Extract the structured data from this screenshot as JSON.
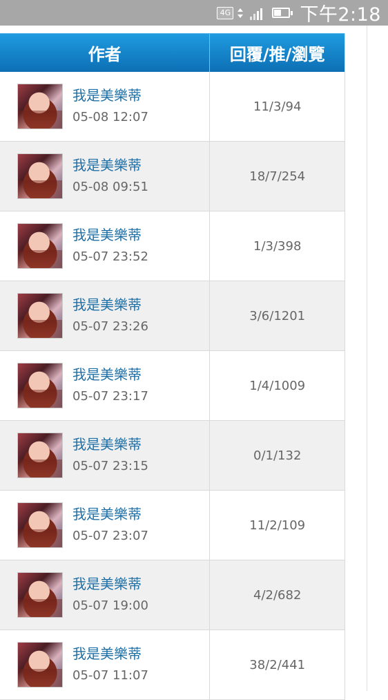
{
  "status_bar": {
    "network": "4G",
    "time": "下午2:18",
    "icons": [
      "network-4g-icon",
      "data-arrows-icon",
      "signal-icon",
      "battery-icon"
    ],
    "bar_color": "#a7a7a7"
  },
  "table": {
    "headers": [
      "作者",
      "回覆/推/瀏覽"
    ],
    "colors": {
      "header_start": "#1f9be0",
      "header_end": "#0d6fb4",
      "link": "#1e6fa6"
    },
    "rows": [
      {
        "name": "我是美樂蒂",
        "time": "05-08 12:07",
        "stats": "11/3/94"
      },
      {
        "name": "我是美樂蒂",
        "time": "05-08 09:51",
        "stats": "18/7/254"
      },
      {
        "name": "我是美樂蒂",
        "time": "05-07 23:52",
        "stats": "1/3/398"
      },
      {
        "name": "我是美樂蒂",
        "time": "05-07 23:26",
        "stats": "3/6/1201"
      },
      {
        "name": "我是美樂蒂",
        "time": "05-07 23:17",
        "stats": "1/4/1009"
      },
      {
        "name": "我是美樂蒂",
        "time": "05-07 23:15",
        "stats": "0/1/132"
      },
      {
        "name": "我是美樂蒂",
        "time": "05-07 23:07",
        "stats": "11/2/109"
      },
      {
        "name": "我是美樂蒂",
        "time": "05-07 19:00",
        "stats": "4/2/682"
      },
      {
        "name": "我是美樂蒂",
        "time": "05-07 11:07",
        "stats": "38/2/441"
      }
    ]
  }
}
